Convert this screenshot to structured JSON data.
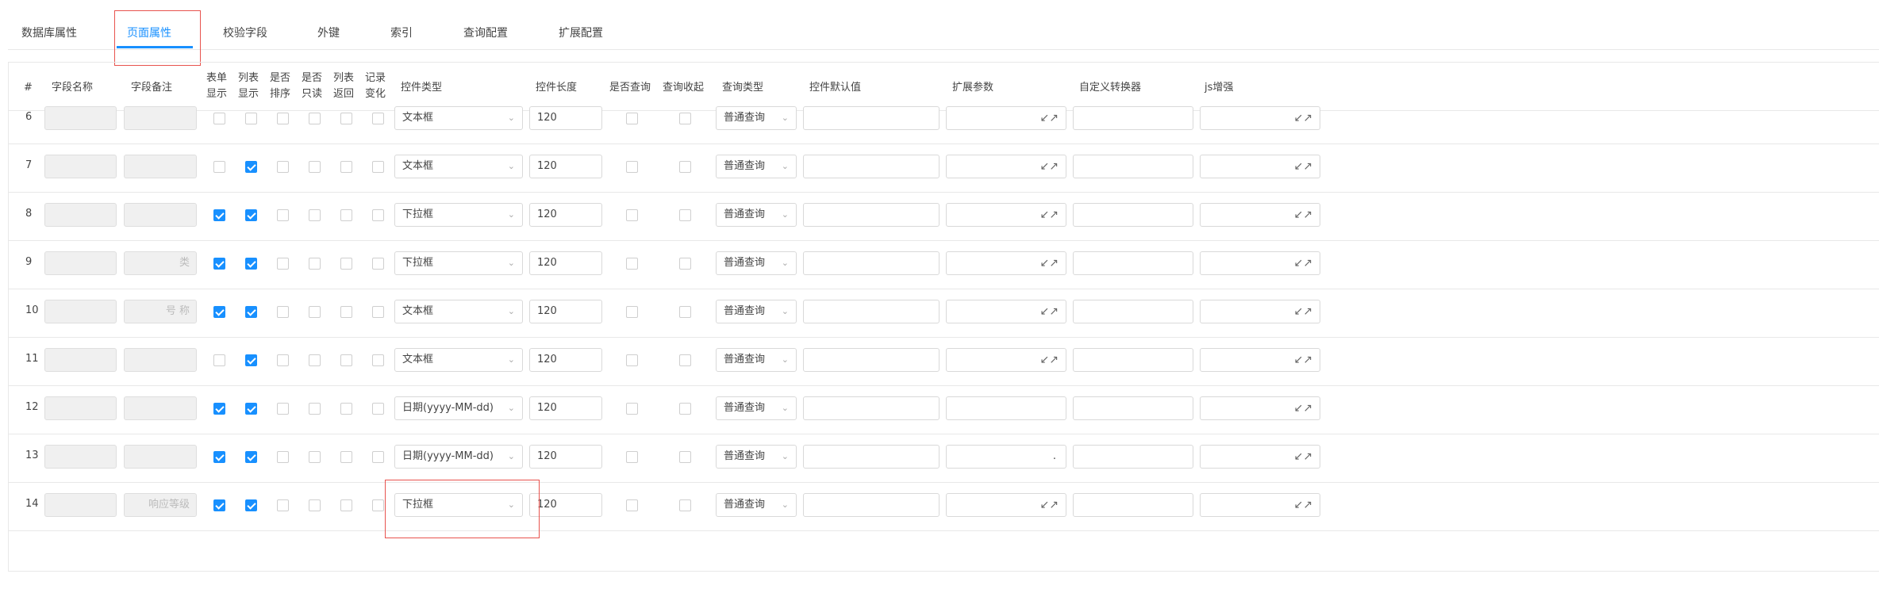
{
  "tabs": [
    "数据库属性",
    "页面属性",
    "校验字段",
    "外键",
    "索引",
    "查询配置",
    "扩展配置"
  ],
  "active_tab": 1,
  "headers": {
    "idx": "#",
    "field_name": "字段名称",
    "field_comment": "字段备注",
    "form_show": [
      "表单",
      "显示"
    ],
    "list_show": [
      "列表",
      "显示"
    ],
    "sortable": [
      "是否",
      "排序"
    ],
    "readonly": [
      "是否",
      "只读"
    ],
    "list_return": [
      "列表",
      "返回"
    ],
    "record_change": [
      "记录",
      "变化"
    ],
    "control_type": "控件类型",
    "control_length": "控件长度",
    "is_query": "是否查询",
    "query_collapse": "查询收起",
    "query_type": "查询类型",
    "control_default": "控件默认值",
    "ext_params": "扩展参数",
    "custom_converter": "自定义转换器",
    "js_enhance": "js增强"
  },
  "rows": [
    {
      "idx": "6",
      "comment": "",
      "form": false,
      "list": false,
      "control": "文本框",
      "length": "120",
      "query_type": "普通查询",
      "ext": "",
      "ext_icon": true
    },
    {
      "idx": "7",
      "comment": "",
      "form": false,
      "list": true,
      "control": "文本框",
      "length": "120",
      "query_type": "普通查询",
      "ext": "",
      "ext_icon": true
    },
    {
      "idx": "8",
      "comment": "",
      "form": true,
      "list": true,
      "control": "下拉框",
      "length": "120",
      "query_type": "普通查询",
      "ext": "",
      "ext_icon": true
    },
    {
      "idx": "9",
      "comment": "类",
      "form": true,
      "list": true,
      "control": "下拉框",
      "length": "120",
      "query_type": "普通查询",
      "ext": "",
      "ext_icon": true
    },
    {
      "idx": "10",
      "comment": "号 称",
      "form": true,
      "list": true,
      "control": "文本框",
      "length": "120",
      "query_type": "普通查询",
      "ext": "",
      "ext_icon": true
    },
    {
      "idx": "11",
      "comment": "",
      "form": false,
      "list": true,
      "control": "文本框",
      "length": "120",
      "query_type": "普通查询",
      "ext": "",
      "ext_icon": true
    },
    {
      "idx": "12",
      "comment": "",
      "form": true,
      "list": true,
      "control": "日期(yyyy-MM-dd)",
      "length": "120",
      "query_type": "普通查询",
      "ext": "",
      "ext_icon": false
    },
    {
      "idx": "13",
      "comment": "",
      "form": true,
      "list": true,
      "control": "日期(yyyy-MM-dd)",
      "length": "120",
      "query_type": "普通查询",
      "ext": ".",
      "ext_icon": false
    },
    {
      "idx": "14",
      "comment": "响应等级",
      "form": true,
      "list": true,
      "control": "下拉框",
      "length": "120",
      "query_type": "普通查询",
      "ext": "",
      "ext_icon": true
    }
  ],
  "icons": {
    "chevron": "chevron-down-icon",
    "expand": "expand-icon"
  },
  "colors": {
    "accent": "#1890ff",
    "highlight": "#e8534e",
    "border": "#d9d9d9"
  }
}
